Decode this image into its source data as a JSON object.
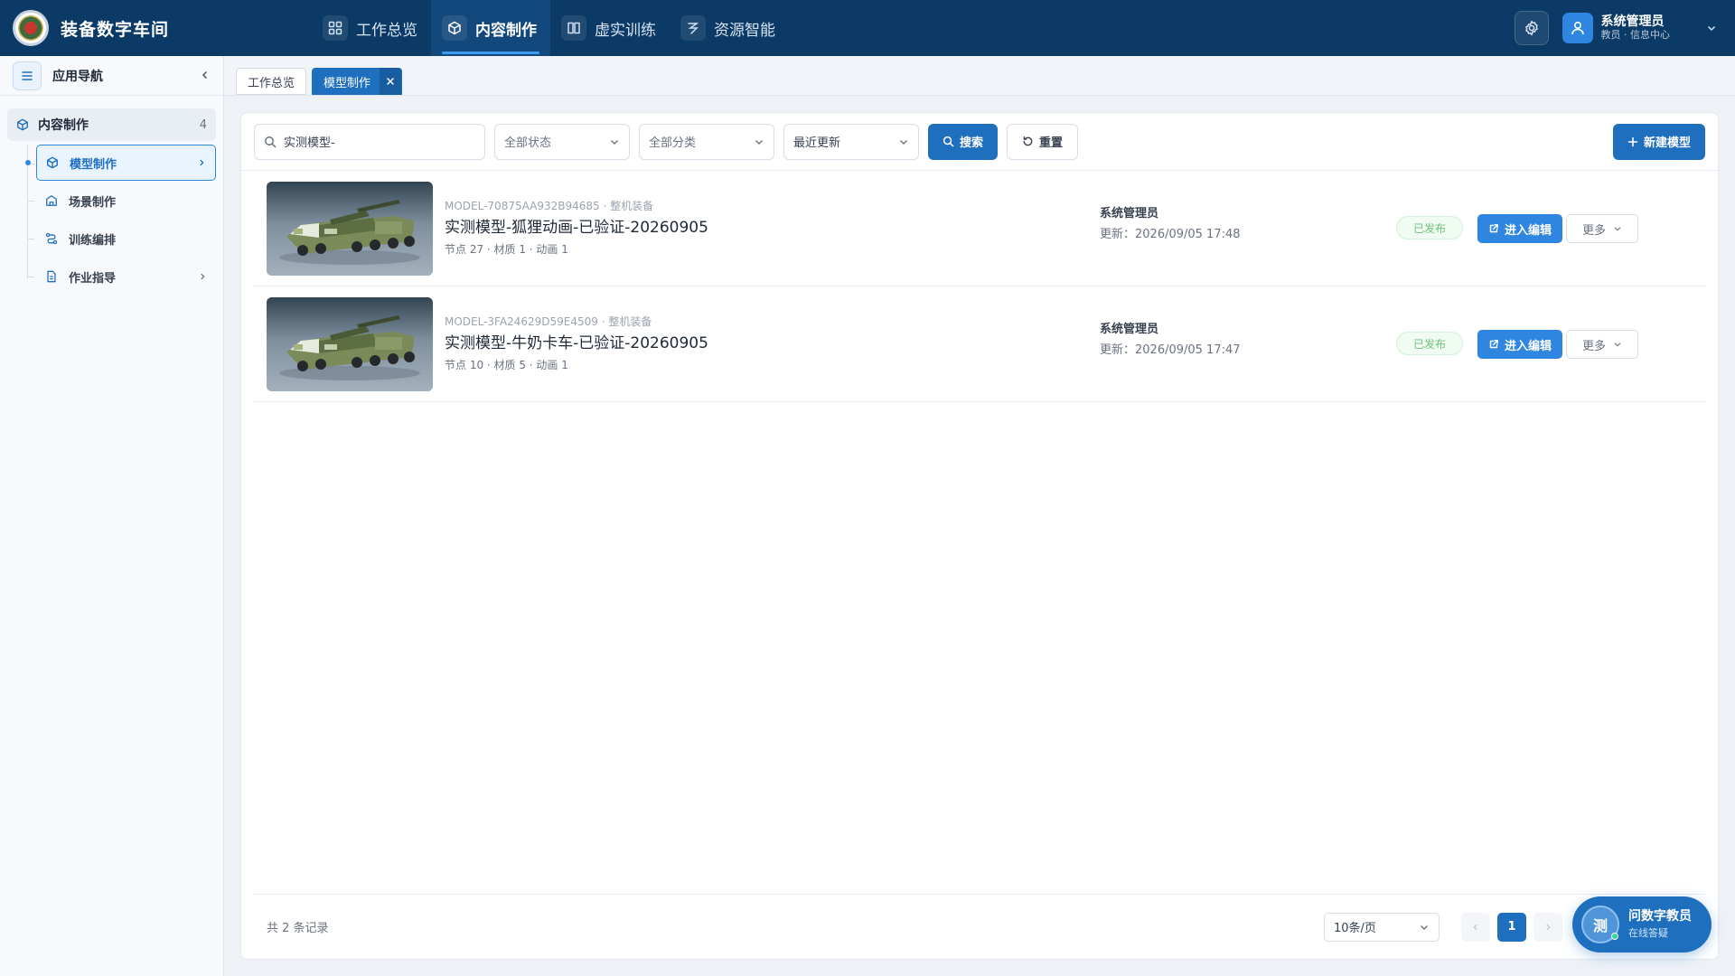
{
  "app": {
    "title": "装备数字车间"
  },
  "topnav": {
    "items": [
      {
        "label": "工作总览",
        "icon": "grid-icon",
        "active": false
      },
      {
        "label": "内容制作",
        "icon": "cube-icon",
        "active": true
      },
      {
        "label": "虚实训练",
        "icon": "book-icon",
        "active": false
      },
      {
        "label": "资源智能",
        "icon": "ai-icon",
        "active": false
      }
    ]
  },
  "user": {
    "name": "系统管理员",
    "role": "教员 · 信息中心"
  },
  "sidebar": {
    "title": "应用导航",
    "group": {
      "label": "内容制作",
      "count": "4"
    },
    "items": [
      {
        "label": "模型制作",
        "icon": "cube-icon",
        "active": true,
        "has_children": true
      },
      {
        "label": "场景制作",
        "icon": "building-icon",
        "active": false,
        "has_children": false
      },
      {
        "label": "训练编排",
        "icon": "flow-icon",
        "active": false,
        "has_children": false
      },
      {
        "label": "作业指导",
        "icon": "document-icon",
        "active": false,
        "has_children": true
      }
    ]
  },
  "tabs": [
    {
      "label": "工作总览",
      "active": false
    },
    {
      "label": "模型制作",
      "active": true
    }
  ],
  "filters": {
    "search_value": "实测模型-",
    "status_select": "全部状态",
    "category_select": "全部分类",
    "sort_select": "最近更新",
    "search_button": "搜索",
    "reset_button": "重置",
    "new_button": "新建模型"
  },
  "models": [
    {
      "code": "MODEL-70875AA932B94685 · 整机装备",
      "name": "实测模型-狐狸动画-已验证-20260905",
      "meta": "节点 27 · 材质 1 · 动画 1",
      "owner": "系统管理员",
      "updated": "更新：2026/09/05 17:48",
      "status": "已发布",
      "edit_label": "进入编辑",
      "more_label": "更多"
    },
    {
      "code": "MODEL-3FA24629D59E4509 · 整机装备",
      "name": "实测模型-牛奶卡车-已验证-20260905",
      "meta": "节点 10 · 材质 5 · 动画 1",
      "owner": "系统管理员",
      "updated": "更新：2026/09/05 17:47",
      "status": "已发布",
      "edit_label": "进入编辑",
      "more_label": "更多"
    }
  ],
  "footer": {
    "total": "共 2 条记录",
    "page_size": "10条/页",
    "current_page": "1"
  },
  "assistant": {
    "avatar_text": "测",
    "title": "问数字教员",
    "subtitle": "在线答疑"
  },
  "colors": {
    "topbar": "#0b3a66",
    "primary": "#1f6fbf",
    "accent": "#2f86e0",
    "published": "#6cc27c"
  }
}
